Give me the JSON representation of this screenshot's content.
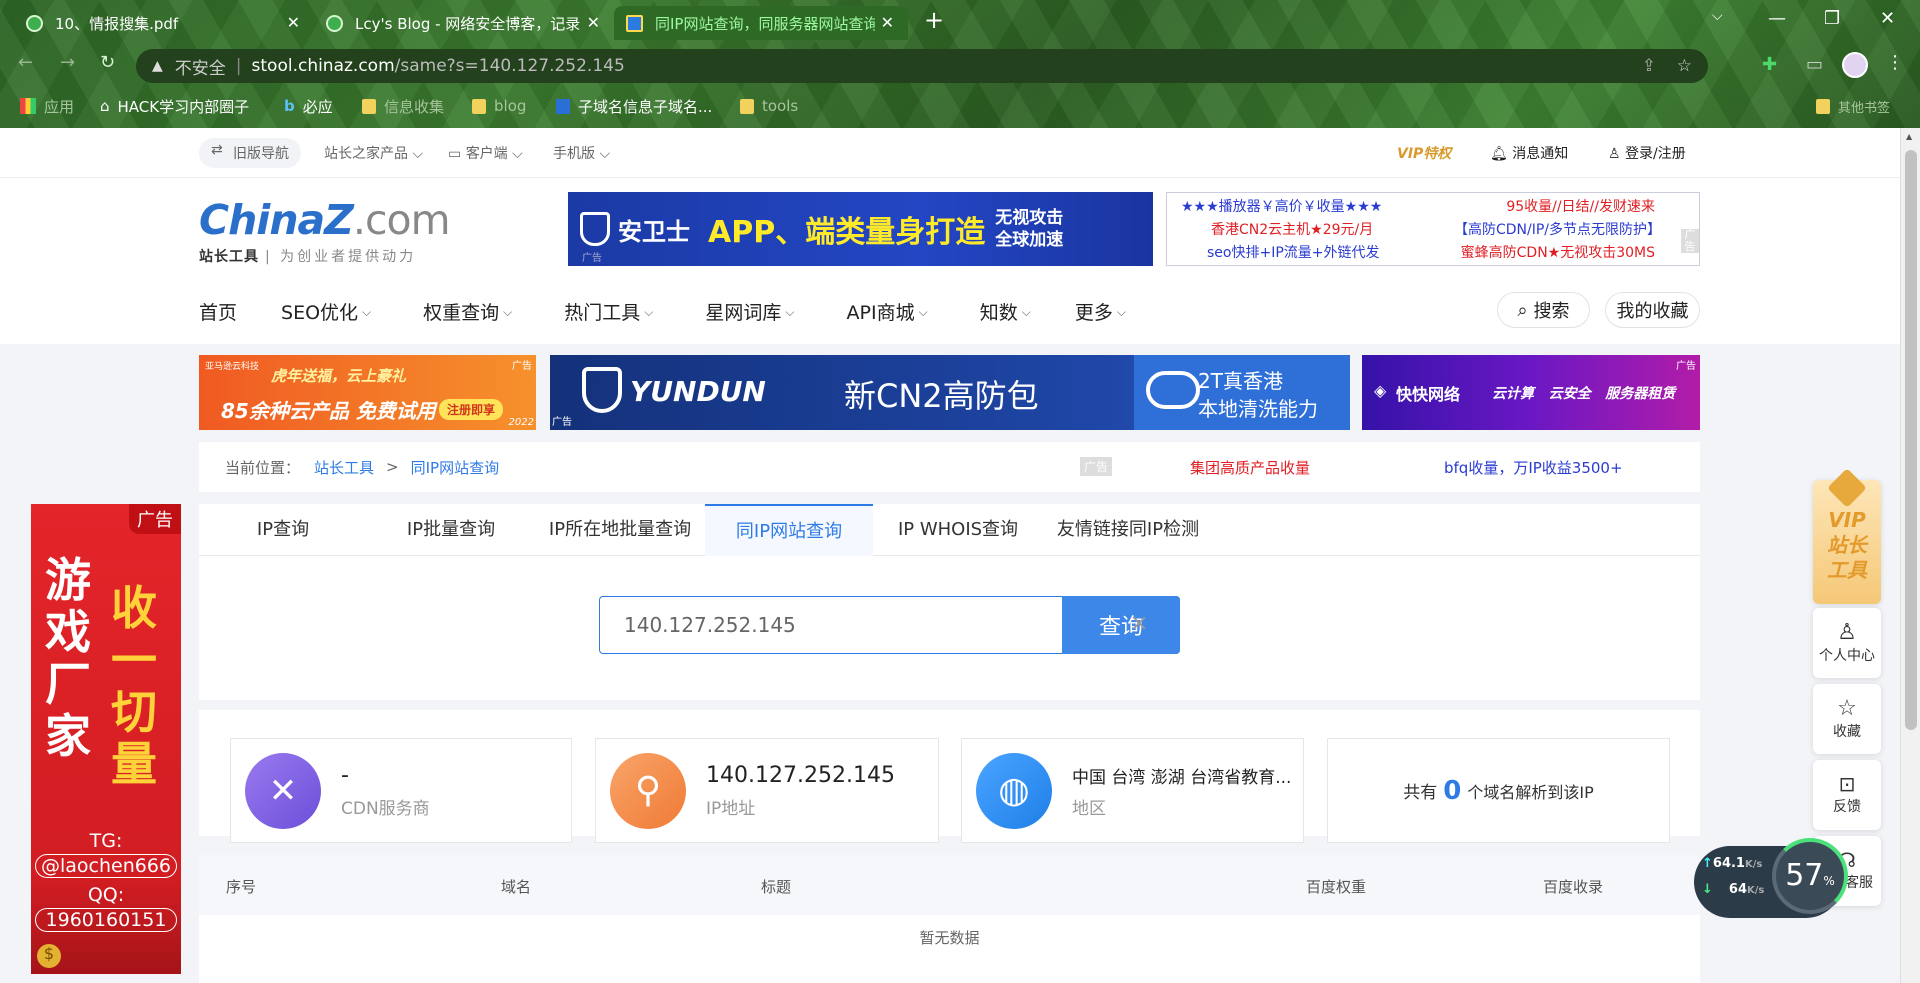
{
  "browser": {
    "tabs": [
      {
        "title": "10、情报搜集.pdf",
        "active": false
      },
      {
        "title": "Lcy's Blog - 网络安全博客，记录",
        "active": false
      },
      {
        "title": "同IP网站查询，同服务器网站查询",
        "active": true
      }
    ],
    "new_tab": "+",
    "security": "不安全",
    "url_host": "stool.chinaz.com",
    "url_path": "/same?s=140.127.252.145",
    "bookmarks": [
      "应用",
      "HACK学习内部圈子",
      "必应",
      "信息收集",
      "blog",
      "子域名信息子域名...",
      "tools",
      "其他书签"
    ]
  },
  "topbar": {
    "old_nav": "旧版导航",
    "products": "站长之家产品",
    "client": "客户端",
    "mobile": "手机版",
    "vip": "VIP特权",
    "notify": "消息通知",
    "login": "登录/注册"
  },
  "logo": {
    "main": "ChinaZ",
    "dot": ".com",
    "sub1": "站长工具",
    "sub2": "为创业者提供动力"
  },
  "ad_banner": {
    "brand": "安卫士",
    "text": "APP、端类量身打造",
    "side1": "无视攻击",
    "side2": "全球加速",
    "tag": "广告"
  },
  "ad_links": [
    [
      "★★★播放器￥高价￥收量★★★",
      "95收量//日结//发财速来"
    ],
    [
      "香港CN2云主机★29元/月",
      "【高防CDN/IP/多节点无限防护】"
    ],
    [
      "seo快排+IP流量+外链代发",
      "蜜蜂高防CDN★无视攻击30MS"
    ]
  ],
  "nav": {
    "items": [
      "首页",
      "SEO优化",
      "权重查询",
      "热门工具",
      "星网词库",
      "API商城",
      "知数",
      "更多"
    ],
    "search": "搜索",
    "favorites": "我的收藏"
  },
  "banners": {
    "b1_brand": "亚马逊云科技",
    "b1_line1": "虎年送福，云上豪礼",
    "b1_line2": "85余种云产品 免费试用",
    "b1_btn": "注册即享",
    "b1_year": "2022",
    "b2_brand": "YUNDUN",
    "b2_text": "新CN2高防包",
    "b2_side1": "2T真香港",
    "b2_side2": "本地清洗能力",
    "b3_brand": "快快网络",
    "b3_items": "云计算   云安全   服务器租赁",
    "ad": "广告"
  },
  "breadcrumb": {
    "label": "当前位置：",
    "home": "站长工具",
    "sep": ">",
    "current": "同IP网站查询",
    "ad_tag": "广告",
    "link1": "集团高质产品收量",
    "link2": "bfq收量，万IP收益3500+"
  },
  "tool_tabs": [
    "IP查询",
    "IP批量查询",
    "IP所在地批量查询",
    "同IP网站查询",
    "IP WHOIS查询",
    "友情链接同IP检测"
  ],
  "search": {
    "value": "140.127.252.145",
    "button": "查询",
    "clear": "×"
  },
  "stats": {
    "cdn_value": "-",
    "cdn_label": "CDN服务商",
    "ip_value": "140.127.252.145",
    "ip_label": "IP地址",
    "region_value": "中国 台湾 澎湖 台湾省教育...",
    "region_label": "地区",
    "count_prefix": "共有",
    "count": "0",
    "count_suffix": "个域名解析到该IP"
  },
  "table": {
    "headers": [
      "序号",
      "域名",
      "标题",
      "百度权重",
      "百度收录"
    ],
    "empty": "暂无数据"
  },
  "side_ad": {
    "tag": "广告",
    "col1": "游戏厂家",
    "col2": "收一切量",
    "tg_label": "TG:",
    "tg": "@laochen666",
    "qq_label": "QQ:",
    "qq": "1960160151"
  },
  "right_tools": {
    "vip1": "VIP",
    "vip2": "站长",
    "vip3": "工具",
    "user": "个人中心",
    "fav": "收藏",
    "feedback": "反馈",
    "service": "客服"
  },
  "speed": {
    "up": "64.1",
    "down": "64",
    "unit": "K/s",
    "percent": "57",
    "pct_sign": "%"
  },
  "colors": {
    "accent": "#2f7be5",
    "chrome_green": "#3c7d2f",
    "ad_red": "#e01f25"
  }
}
